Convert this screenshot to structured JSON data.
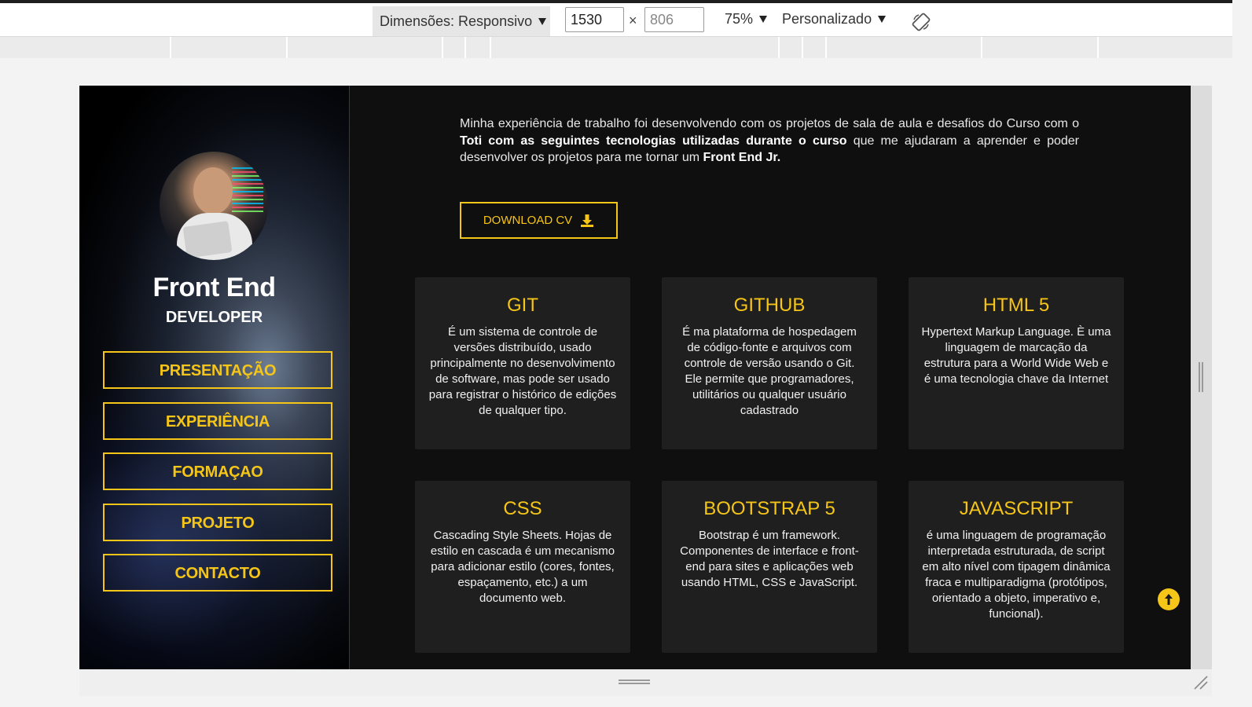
{
  "toolbar": {
    "dimensions_label": "Dimensões: Responsivo",
    "width_value": "1530",
    "height_value": "806",
    "times": "×",
    "zoom_label": "75%",
    "throttle_label": "Personalizado"
  },
  "sidebar": {
    "name": "Front End",
    "role": "DEVELOPER",
    "nav": [
      "PRESENTAÇÃO",
      "EXPERIÊNCIA",
      "FORMAÇAO",
      "PROJETO",
      "CONTACTO"
    ]
  },
  "main": {
    "intro_1": "Minha experiência de trabalho foi desenvolvendo com os projetos de sala de aula e desafios do Curso com o ",
    "intro_bold_1": "Toti com as seguintes tecnologias utilizadas durante o curso",
    "intro_2": " que me ajudaram a aprender e poder desenvolver os projetos para me tornar um ",
    "intro_bold_2": "Front End Jr.",
    "download_label": "DOWNLOAD CV"
  },
  "cards": [
    {
      "title": "GIT",
      "text": "É um sistema de controle de versões distribuído, usado principalmente no desenvolvimento de software, mas pode ser usado para registrar o histórico de edições de qualquer tipo."
    },
    {
      "title": "GITHUB",
      "text": "É ma plataforma de hospedagem de código-fonte e arquivos com controle de versão usando o Git. Ele permite que programadores, utilitários ou qualquer usuário cadastrado"
    },
    {
      "title": "HTML 5",
      "text": "Hypertext Markup Language. È uma linguagem de marcação da estrutura para a World Wide Web e é uma tecnologia chave da Internet"
    },
    {
      "title": "CSS",
      "text": "Cascading Style Sheets. Hojas de estilo en cascada é um mecanismo para adicionar estilo (cores, fontes, espaçamento, etc.) a um documento web."
    },
    {
      "title": "BOOTSTRAP 5",
      "text": "Bootstrap é um framework. Componentes de interface e front-end para sites e aplicações web usando HTML, CSS e JavaScript."
    },
    {
      "title": "JAVASCRIPT",
      "text": "é uma linguagem de programação interpretada estruturada, de script em alto nível com tipagem dinâmica fraca e multiparadigma (protótipos, orientado a objeto, imperativo e, funcional)."
    }
  ],
  "colors": {
    "accent": "#f5c518",
    "page_bg": "#0f0f0f",
    "card_bg": "#1f1f1f"
  }
}
